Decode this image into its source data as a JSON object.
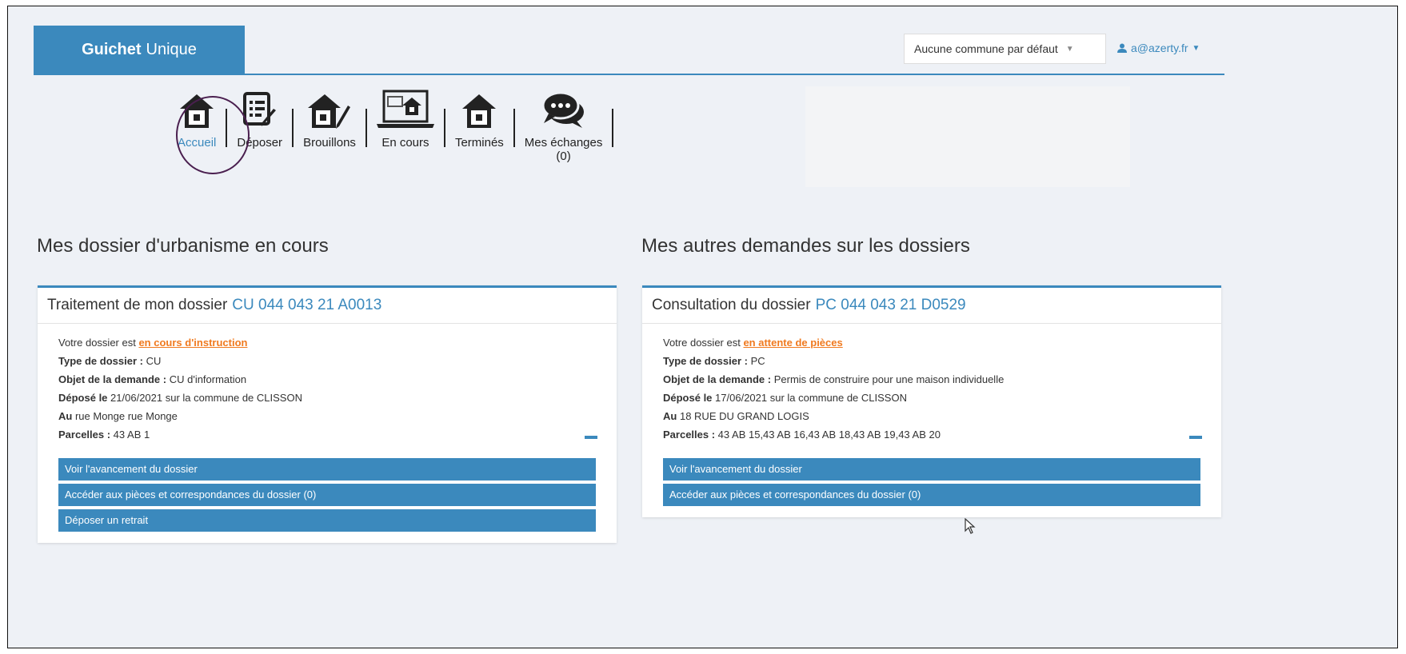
{
  "header": {
    "brand_bold": "Guichet",
    "brand_rest": "Unique",
    "commune_select": "Aucune commune par défaut",
    "user_email": "a@azerty.fr"
  },
  "nav": {
    "items": [
      {
        "label": "Accueil",
        "icon": "house-icon",
        "active": true
      },
      {
        "label": "Déposer",
        "icon": "document-edit-icon"
      },
      {
        "label": "Brouillons",
        "icon": "house-pencil-icon"
      },
      {
        "label": "En cours",
        "icon": "laptop-house-icon"
      },
      {
        "label": "Terminés",
        "icon": "house-icon"
      },
      {
        "label": "Mes échanges",
        "sublabel": "(0)",
        "icon": "chat-bubbles-icon"
      }
    ]
  },
  "sections": {
    "left_title": "Mes dossier d'urbanisme en cours",
    "right_title": "Mes autres demandes sur les dossiers"
  },
  "cards": [
    {
      "title_prefix": "Traitement de mon dossier",
      "ref": "CU 044 043 21 A0013",
      "status_prefix": "Votre dossier est",
      "status": "en cours d'instruction",
      "type_label": "Type de dossier :",
      "type_value": "CU",
      "objet_label": "Objet de la demande :",
      "objet_value": "CU d'information",
      "depose_label": "Déposé le",
      "depose_value": "21/06/2021 sur la commune de CLISSON",
      "au_label": "Au",
      "au_value": "rue Monge rue Monge",
      "parcelles_label": "Parcelles :",
      "parcelles_value": "43 AB 1",
      "actions": [
        "Voir l'avancement du dossier",
        "Accéder aux pièces et correspondances du dossier (0)",
        "Déposer un retrait"
      ]
    },
    {
      "title_prefix": "Consultation du dossier",
      "ref": "PC 044 043 21 D0529",
      "status_prefix": "Votre dossier est",
      "status": "en attente de pièces",
      "type_label": "Type de dossier :",
      "type_value": "PC",
      "objet_label": "Objet de la demande :",
      "objet_value": "Permis de construire pour une maison individuelle",
      "depose_label": "Déposé le",
      "depose_value": "17/06/2021 sur la commune de CLISSON",
      "au_label": "Au",
      "au_value": "18 RUE DU GRAND LOGIS",
      "parcelles_label": "Parcelles :",
      "parcelles_value": "43 AB 15,43 AB 16,43 AB 18,43 AB 19,43 AB 20",
      "actions": [
        "Voir l'avancement du dossier",
        "Accéder aux pièces et correspondances du dossier (0)"
      ]
    }
  ],
  "colors": {
    "accent": "#3b89bd",
    "status": "#f07a1f",
    "background": "#eef1f6"
  }
}
